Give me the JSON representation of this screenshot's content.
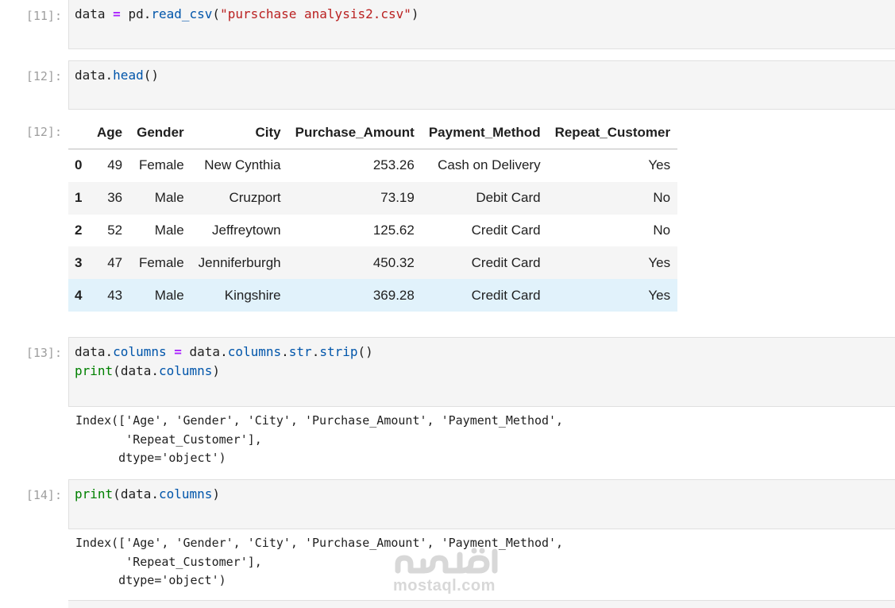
{
  "cells": [
    {
      "prompt": "[11]:",
      "code": {
        "var": "data",
        "op": "=",
        "mod": "pd",
        "fn": "read_csv",
        "arg": "\"purschase analysis2.csv\""
      }
    },
    {
      "prompt": "[12]:",
      "code": {
        "var": "data",
        "fn": "head"
      }
    },
    {
      "prompt": "[12]:"
    },
    {
      "prompt": "[13]:",
      "code": {
        "line1": {
          "var": "data",
          "attr": "columns",
          "op": "=",
          "rhs_var": "data",
          "rhs_attr1": "columns",
          "rhs_attr2": "str",
          "rhs_fn": "strip"
        },
        "line2": {
          "fn": "print",
          "var": "data",
          "attr": "columns"
        }
      }
    },
    {
      "prompt": "[14]:",
      "code": {
        "fn": "print",
        "var": "data",
        "attr": "columns"
      }
    }
  ],
  "dataframe": {
    "columns": [
      "",
      "Age",
      "Gender",
      "City",
      "Purchase_Amount",
      "Payment_Method",
      "Repeat_Customer"
    ],
    "rows": [
      {
        "index": "0",
        "age": "49",
        "gender": "Female",
        "city": "New Cynthia",
        "amount": "253.26",
        "method": "Cash on Delivery",
        "repeat": "Yes"
      },
      {
        "index": "1",
        "age": "36",
        "gender": "Male",
        "city": "Cruzport",
        "amount": "73.19",
        "method": "Debit Card",
        "repeat": "No"
      },
      {
        "index": "2",
        "age": "52",
        "gender": "Male",
        "city": "Jeffreytown",
        "amount": "125.62",
        "method": "Credit Card",
        "repeat": "No"
      },
      {
        "index": "3",
        "age": "47",
        "gender": "Female",
        "city": "Jenniferburgh",
        "amount": "450.32",
        "method": "Credit Card",
        "repeat": "Yes"
      },
      {
        "index": "4",
        "age": "43",
        "gender": "Male",
        "city": "Kingshire",
        "amount": "369.28",
        "method": "Credit Card",
        "repeat": "Yes"
      }
    ]
  },
  "outputs": {
    "out13": [
      "Index(['Age', 'Gender', 'City', 'Purchase_Amount', 'Payment_Method',",
      "       'Repeat_Customer'],",
      "      dtype='object')"
    ],
    "out14": [
      "Index(['Age', 'Gender', 'City', 'Purchase_Amount', 'Payment_Method',",
      "       'Repeat_Customer'],",
      "      dtype='object')"
    ]
  },
  "watermark": {
    "text": "mostaql.com",
    "logo_icon": "mostaql-logo-icon",
    "color": "#d8d8d8"
  }
}
